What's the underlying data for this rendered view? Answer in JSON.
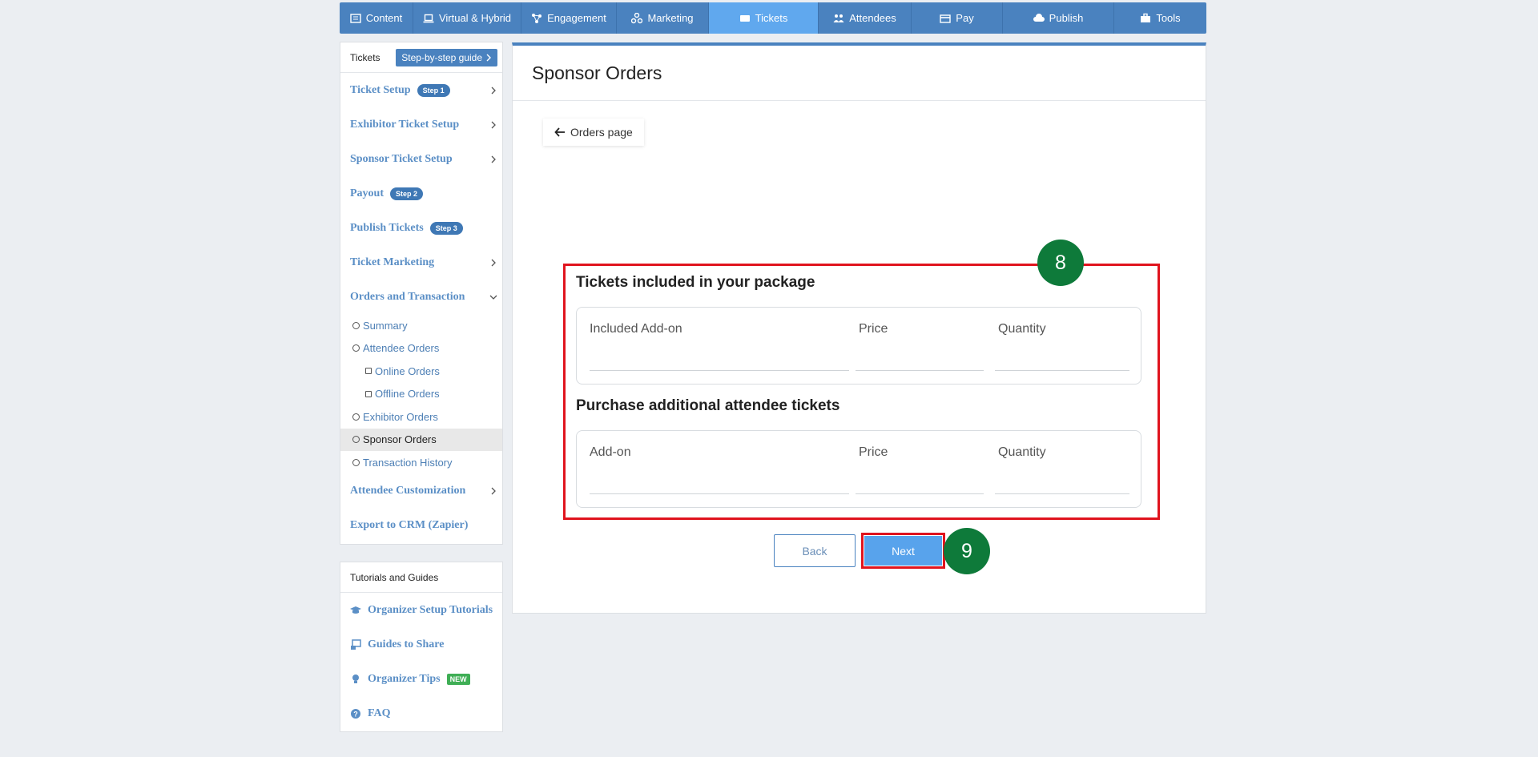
{
  "topnav": [
    {
      "label": "Content",
      "icon": "content-icon"
    },
    {
      "label": "Virtual & Hybrid",
      "icon": "laptop-icon"
    },
    {
      "label": "Engagement",
      "icon": "network-icon"
    },
    {
      "label": "Marketing",
      "icon": "share-icon"
    },
    {
      "label": "Tickets",
      "icon": "ticket-icon",
      "active": true
    },
    {
      "label": "Attendees",
      "icon": "users-icon"
    },
    {
      "label": "Pay",
      "icon": "credit-card-icon"
    },
    {
      "label": "Publish",
      "icon": "cloud-upload-icon"
    },
    {
      "label": "Tools",
      "icon": "toolbox-icon"
    }
  ],
  "sidebar": {
    "title": "Tickets",
    "guide_button": "Step-by-step guide",
    "items": {
      "ticket_setup": {
        "label": "Ticket Setup",
        "step": "Step 1"
      },
      "exhibitor_setup": {
        "label": "Exhibitor Ticket Setup"
      },
      "sponsor_setup": {
        "label": "Sponsor Ticket Setup"
      },
      "payout": {
        "label": "Payout",
        "step": "Step 2"
      },
      "publish": {
        "label": "Publish Tickets",
        "step": "Step 3"
      },
      "marketing": {
        "label": "Ticket Marketing"
      },
      "orders": {
        "label": "Orders and Transaction"
      },
      "customization": {
        "label": "Attendee Customization"
      },
      "export": {
        "label": "Export to CRM (Zapier)"
      }
    },
    "sub": {
      "summary": "Summary",
      "attendee_orders": "Attendee Orders",
      "online_orders": "Online Orders",
      "offline_orders": "Offline Orders",
      "exhibitor_orders": "Exhibitor Orders",
      "sponsor_orders": "Sponsor Orders",
      "transaction_history": "Transaction History"
    }
  },
  "tutorials": {
    "title": "Tutorials and Guides",
    "setup": "Organizer Setup Tutorials",
    "share": "Guides to Share",
    "tips": "Organizer Tips",
    "tips_badge": "NEW",
    "faq": "FAQ"
  },
  "main": {
    "title": "Sponsor Orders",
    "back_link": "Orders page",
    "included": {
      "title": "Tickets included in your package",
      "cols": [
        "Included Add-on",
        "Price",
        "Quantity"
      ]
    },
    "additional": {
      "title": "Purchase additional attendee tickets",
      "cols": [
        "Add-on",
        "Price",
        "Quantity"
      ]
    },
    "back_button": "Back",
    "next_button": "Next"
  },
  "annotations": {
    "a": "8",
    "b": "9"
  },
  "colors": {
    "nav": "#4a82bf",
    "active": "#60a8ee",
    "highlight": "#e0141e",
    "badge": "#0e7a3a"
  }
}
